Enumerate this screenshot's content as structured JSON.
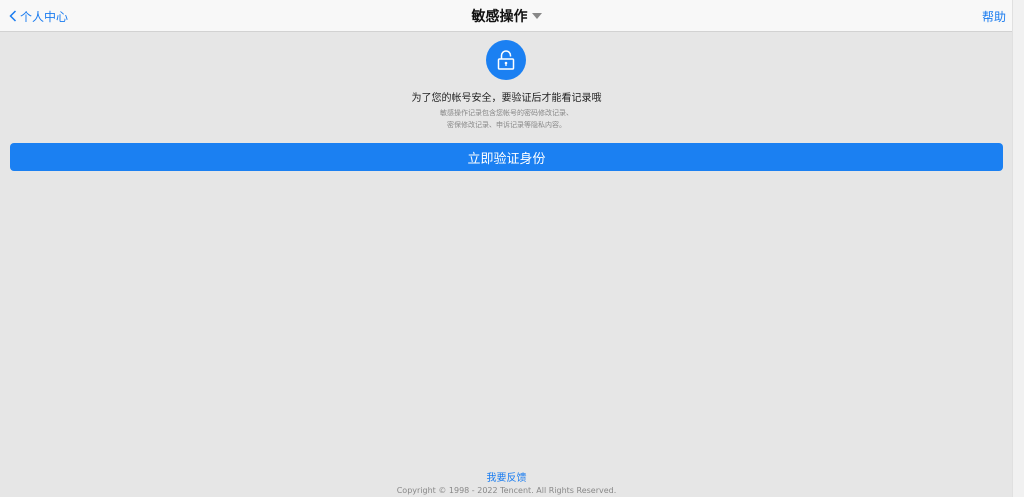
{
  "header": {
    "back_label": "个人中心",
    "title": "敏感操作",
    "help_label": "帮助"
  },
  "main": {
    "headline": "为了您的帐号安全，要验证后才能看记录哦",
    "desc_line1": "敏感操作记录包含您帐号的密码修改记录、",
    "desc_line2": "密保修改记录、申诉记录等隐私内容。",
    "verify_button": "立即验证身份"
  },
  "footer": {
    "feedback": "我要反馈",
    "copyright": "Copyright © 1998 - 2022 Tencent. All Rights Reserved."
  },
  "colors": {
    "accent": "#1b80f2",
    "background": "#e6e6e6",
    "link": "#1a7cf0"
  },
  "icons": {
    "back": "chevron-left-icon",
    "title_dropdown": "caret-down-icon",
    "lock": "lock-icon"
  }
}
